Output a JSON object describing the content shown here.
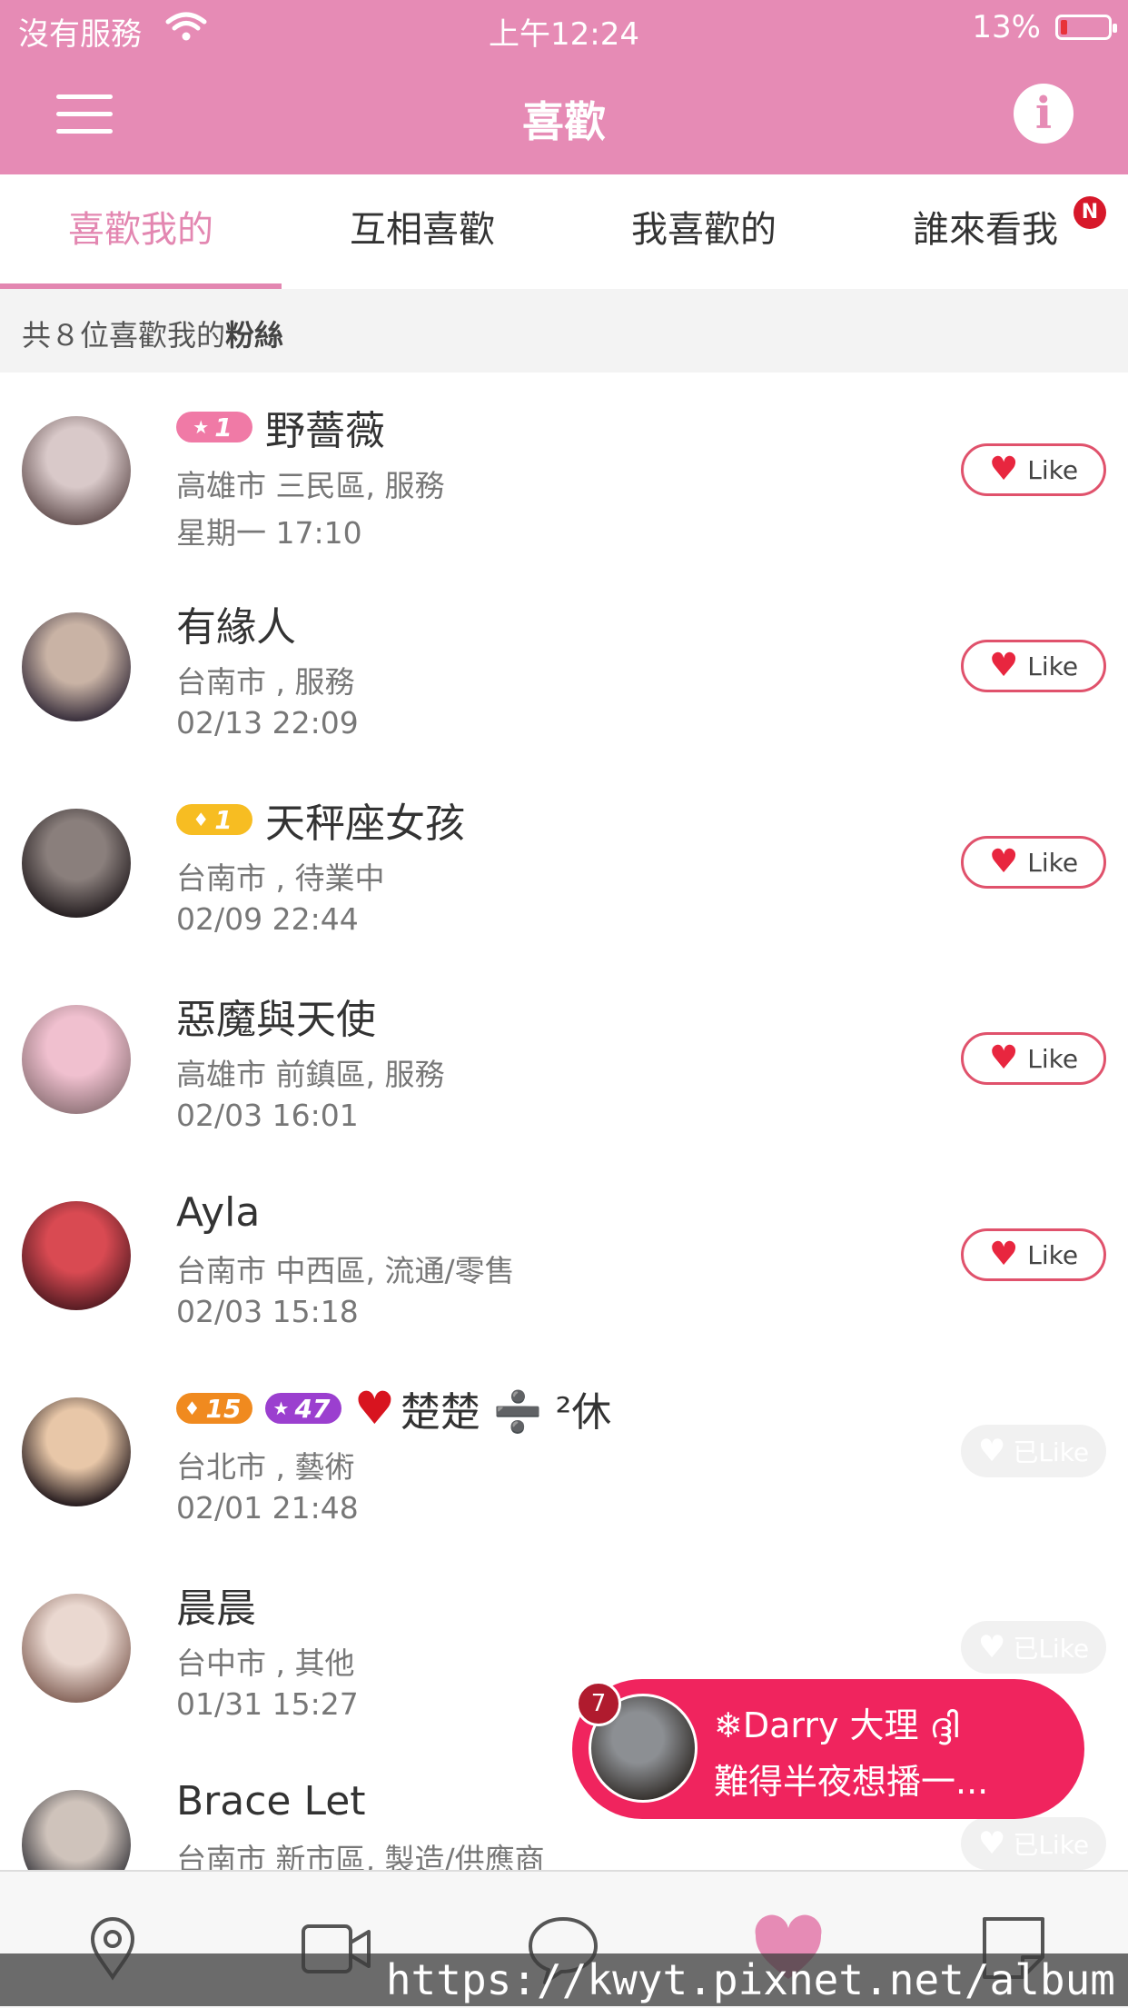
{
  "status_bar": {
    "carrier": "沒有服務",
    "time": "上午12:24",
    "battery": "13%",
    "battery_level": 0.13
  },
  "header": {
    "title": "喜歡",
    "menu_icon": "hamburger-menu-icon",
    "info_icon": "info-icon",
    "info_glyph": "i"
  },
  "tabs": [
    {
      "label": "喜歡我的",
      "active": true
    },
    {
      "label": "互相喜歡",
      "active": false
    },
    {
      "label": "我喜歡的",
      "active": false
    },
    {
      "label": "誰來看我",
      "active": false,
      "badge": "N"
    }
  ],
  "summary": {
    "prefix": "共８位喜歡我的",
    "emphasis": "粉絲"
  },
  "fans": [
    {
      "badges": [
        {
          "icon": "★",
          "value": "1",
          "color": "pink"
        }
      ],
      "name": "野薔薇",
      "location": "高雄市 三民區, 服務",
      "time": "星期一 17:10",
      "like_label": "Like",
      "liked": false,
      "avatar_colors": [
        "#d9c9c9",
        "#6d5a5a"
      ]
    },
    {
      "badges": [],
      "name": "有緣人",
      "location": "台南市 , 服務",
      "time": "02/13 22:09",
      "like_label": "Like",
      "liked": false,
      "avatar_colors": [
        "#c9b3a5",
        "#3e3440"
      ]
    },
    {
      "badges": [
        {
          "icon": "♦",
          "value": "1",
          "color": "gold"
        }
      ],
      "name": "天秤座女孩",
      "location": "台南市 , 待業中",
      "time": "02/09 22:44",
      "like_label": "Like",
      "liked": false,
      "avatar_colors": [
        "#8a7f7c",
        "#2a2325"
      ]
    },
    {
      "badges": [],
      "name": "惡魔與天使",
      "location": "高雄市 前鎮區, 服務",
      "time": "02/03 16:01",
      "like_label": "Like",
      "liked": false,
      "avatar_colors": [
        "#f0c0cf",
        "#9a7c82"
      ]
    },
    {
      "badges": [],
      "name": "Ayla",
      "location": "台南市 中西區, 流通/零售",
      "time": "02/03 15:18",
      "like_label": "Like",
      "liked": false,
      "avatar_colors": [
        "#d94a52",
        "#5c1e25"
      ]
    },
    {
      "badges": [
        {
          "icon": "♦",
          "value": "15",
          "color": "orange"
        },
        {
          "icon": "★",
          "value": "47",
          "color": "purple"
        }
      ],
      "heart_prefix": "♥",
      "name": "楚楚 ➗ ²休",
      "location": "台北市 , 藝術",
      "time": "02/01 21:48",
      "like_label": "已Like",
      "liked": true,
      "avatar_colors": [
        "#e8c7a8",
        "#2b2022"
      ]
    },
    {
      "badges": [],
      "name": "晨晨",
      "location": "台中市 , 其他",
      "time": "01/31 15:27",
      "like_label": "已Like",
      "liked": true,
      "avatar_colors": [
        "#ead8d0",
        "#8b6b61"
      ]
    },
    {
      "badges": [],
      "name": "Brace Let",
      "location": "台南市 新市區, 製造/供應商",
      "time": "",
      "like_label": "已Like",
      "liked": true,
      "avatar_colors": [
        "#cfc3bb",
        "#3b3a3f"
      ]
    }
  ],
  "live_banner": {
    "count": "7",
    "name": "❄Darry 大理 ദ്ദി",
    "subtitle": "難得半夜想播一...",
    "avatar_colors": [
      "#8c8f93",
      "#2f2a26"
    ]
  },
  "bottom_nav": [
    {
      "icon": "location-pin-icon",
      "active": false
    },
    {
      "icon": "video-camera-icon",
      "active": false
    },
    {
      "icon": "chat-bubble-icon",
      "active": false
    },
    {
      "icon": "heart-icon",
      "active": true
    },
    {
      "icon": "note-icon",
      "active": false
    }
  ],
  "watermark": "https://kwyt.pixnet.net/album",
  "colors": {
    "header": "#e68bb5",
    "accent": "#e387b1",
    "like_border": "#e0526c",
    "live_banner": "#f0245e"
  }
}
